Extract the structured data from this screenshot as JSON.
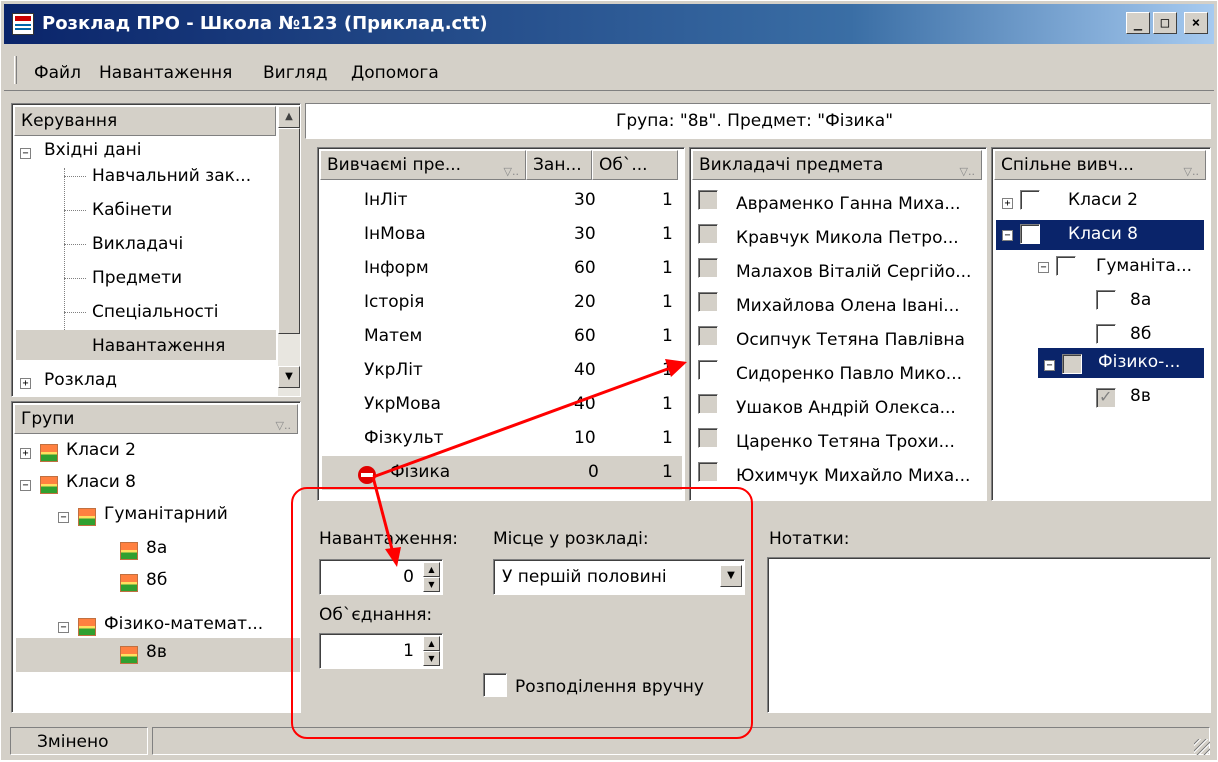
{
  "window": {
    "title": "Розклад ПРО - Школа №123 (Приклад.ctt)"
  },
  "menu": [
    "Файл",
    "Навантаження",
    "Вигляд",
    "Допомога"
  ],
  "control": {
    "header": "Керування",
    "input_data": "Вхідні дані",
    "items": [
      "Навчальний зак...",
      "Кабінети",
      "Викладачі",
      "Предмети",
      "Спеціальності",
      "Навантаження"
    ],
    "schedule": "Розклад"
  },
  "groups": {
    "header": "Групи",
    "classes2": "Класи 2",
    "classes8": "Класи 8",
    "humanities": "Гуманітарний",
    "c8a": "8а",
    "c8b": "8б",
    "physmath": "Фізико-математ...",
    "c8v": "8в"
  },
  "info_line": "Група: \"8в\". Предмет: \"Фізика\"",
  "subjects": {
    "col_subject": "Вивчаємі пре...",
    "col_hours": "Зан...",
    "col_union": "Об`...",
    "rows": [
      {
        "name": "ІнЛіт",
        "hours": "30",
        "union": "1"
      },
      {
        "name": "ІнМова",
        "hours": "30",
        "union": "1"
      },
      {
        "name": "Інформ",
        "hours": "60",
        "union": "1"
      },
      {
        "name": "Історія",
        "hours": "20",
        "union": "1"
      },
      {
        "name": "Матем",
        "hours": "60",
        "union": "1"
      },
      {
        "name": "УкрЛіт",
        "hours": "40",
        "union": "1"
      },
      {
        "name": "УкрМова",
        "hours": "40",
        "union": "1"
      },
      {
        "name": "Фізкульт",
        "hours": "10",
        "union": "1"
      },
      {
        "name": "Фізика",
        "hours": "0",
        "union": "1"
      }
    ]
  },
  "teachers": {
    "header": "Викладачі предмета",
    "rows": [
      "Авраменко Ганна Миха...",
      "Кравчук Микола Петро...",
      "Малахов Віталій Сергійо...",
      "Михайлова Олена Івані...",
      "Осипчук Тетяна Павлівна",
      "Сидоренко Павло Мико...",
      "Ушаков Андрій Олекса...",
      "Царенко Тетяна Трохи...",
      "Юхимчук Михайло Миха..."
    ]
  },
  "joint": {
    "header": "Спільне вивч...",
    "classes2": "Класи 2",
    "classes8": "Класи 8",
    "humanit": "Гуманіта...",
    "c8a": "8а",
    "c8b": "8б",
    "physmath": "Фізико-...",
    "c8v": "8в"
  },
  "form": {
    "load_label": "Навантаження:",
    "load_value": "0",
    "union_label": "Об`єднання:",
    "union_value": "1",
    "place_label": "Місце у розкладі:",
    "place_value": "У першій половині",
    "manual_label": "Розподілення вручну",
    "notes_label": "Нотатки:"
  },
  "status": {
    "text": "Змінено"
  },
  "colors": {
    "title_bar": "#0a246a",
    "selection": "#0a246a",
    "annotation": "#ff0000"
  }
}
